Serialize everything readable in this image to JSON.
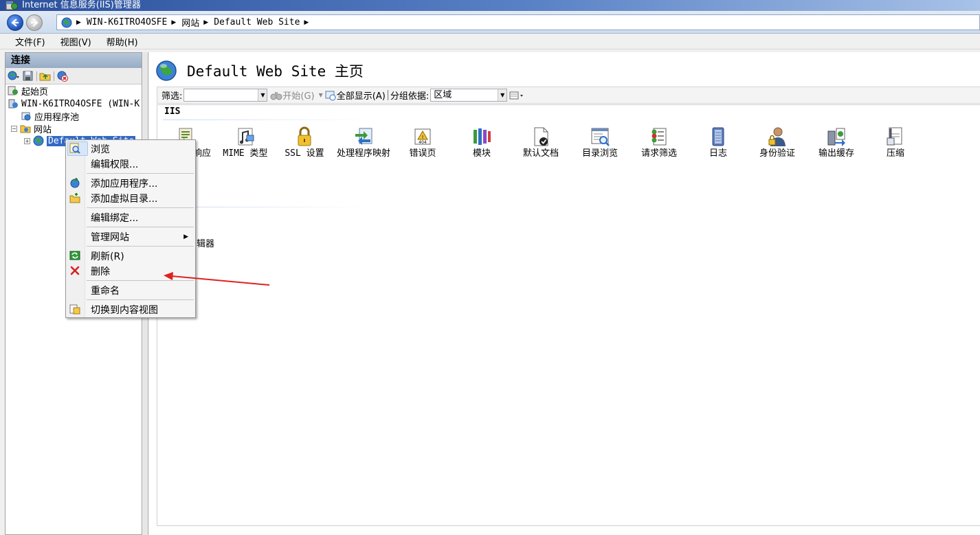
{
  "window": {
    "title": "Internet 信息服务(IIS)管理器"
  },
  "address": {
    "crumbs": [
      "WIN-K6ITRO4OSFE",
      "网站",
      "Default Web Site"
    ]
  },
  "menu": [
    "文件(F)",
    "视图(V)",
    "帮助(H)"
  ],
  "connections": {
    "header": "连接",
    "tree": {
      "start_page": "起始页",
      "server": "WIN-K6ITRO4OSFE (WIN-K",
      "app_pools": "应用程序池",
      "sites": "网站",
      "default_site": "Default Web Site"
    }
  },
  "main": {
    "title": "Default Web Site 主页",
    "filter": {
      "label": "筛选:",
      "start": "开始(G)",
      "show_all": "全部显示(A)",
      "group_by": "分组依据:",
      "group_value": "区域"
    },
    "section": "IIS",
    "features": [
      "响应",
      "MIME 类型",
      "SSL 设置",
      "处理程序映射",
      "错误页",
      "模块",
      "默认文档",
      "目录浏览",
      "请求筛选",
      "日志",
      "身份验证",
      "输出缓存",
      "压缩"
    ],
    "partial_label": "辑器"
  },
  "context_menu": {
    "items": [
      {
        "label": "浏览",
        "icon": "browse-icon"
      },
      {
        "label": "编辑权限..."
      },
      {
        "label": "添加应用程序...",
        "icon": "add-application-icon"
      },
      {
        "label": "添加虚拟目录...",
        "icon": "add-virtual-directory-icon"
      },
      {
        "label": "编辑绑定..."
      },
      {
        "label": "管理网站",
        "submenu": true
      },
      {
        "label": "刷新(R)",
        "icon": "refresh-icon"
      },
      {
        "label": "删除",
        "icon": "delete-icon"
      },
      {
        "label": "重命名"
      },
      {
        "label": "切换到内容视图",
        "icon": "content-view-icon"
      }
    ]
  },
  "colors": {
    "selection": "#3169c6",
    "annotation_arrow": "#e02020",
    "title_bar": "#2a4f9c"
  }
}
